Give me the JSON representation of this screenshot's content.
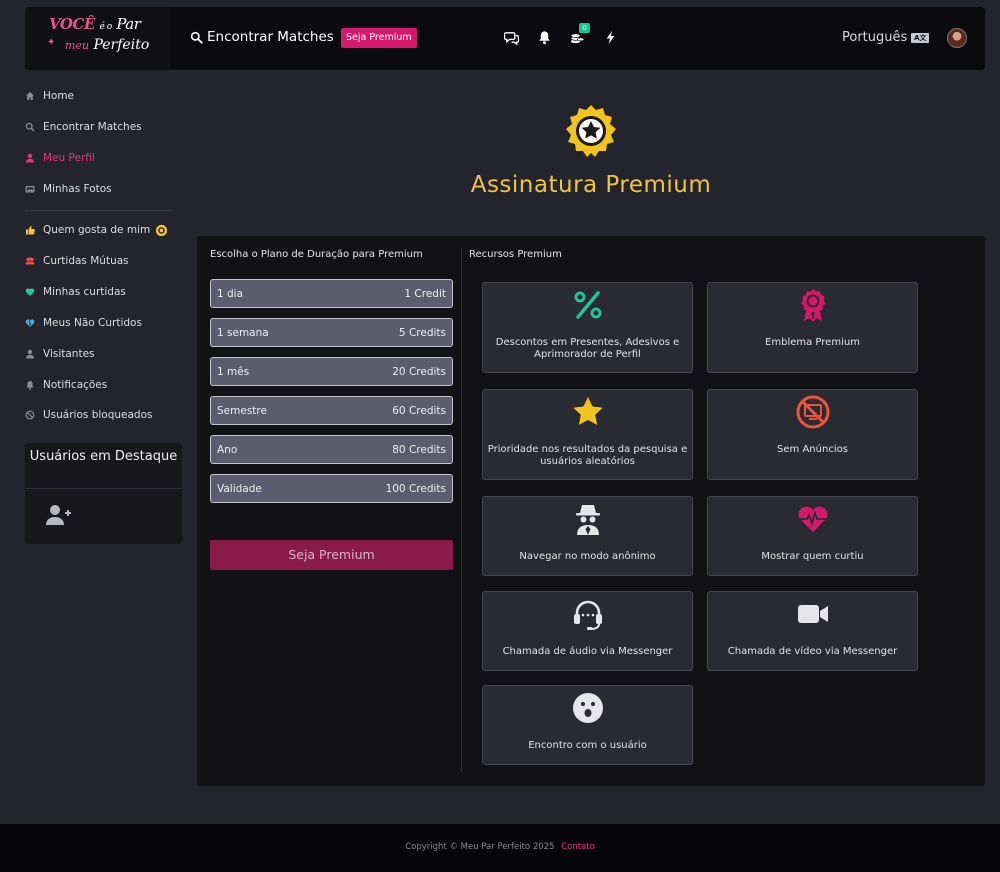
{
  "header": {
    "logo": {
      "line1_a": "VOCÊ",
      "line1_b": "é o",
      "line1_c": "Par",
      "line2_a": "meu",
      "line2_b": "Perfeito"
    },
    "search_label": "Encontrar Matches",
    "premium_badge": "Seja Premium",
    "coins_badge": "0",
    "language": "Português",
    "language_flag": "A文",
    "icons": [
      "chat-icon",
      "bell-icon",
      "coins-icon",
      "bolt-icon"
    ]
  },
  "sidebar": {
    "items": [
      {
        "label": "Home",
        "icon": "home-icon"
      },
      {
        "label": "Encontrar Matches",
        "icon": "search-icon"
      },
      {
        "label": "Meu Perfil",
        "icon": "user-icon",
        "active": true
      },
      {
        "label": "Minhas Fotos",
        "icon": "photos-icon"
      },
      {
        "label": "Quem gosta de mim",
        "icon": "thumbs-up-icon"
      },
      {
        "label": "Curtidas Mútuas",
        "icon": "users-icon"
      },
      {
        "label": "Minhas curtidas",
        "icon": "heart-icon"
      },
      {
        "label": "Meus Não Curtidos",
        "icon": "broken-heart-icon"
      },
      {
        "label": "Visitantes",
        "icon": "visitor-icon"
      },
      {
        "label": "Notificações",
        "icon": "bell-icon"
      },
      {
        "label": "Usuários bloqueados",
        "icon": "ban-icon"
      }
    ],
    "featured_title": "Usuários em Destaque"
  },
  "hero": {
    "title": "Assinatura Premium"
  },
  "plans": {
    "title": "Escolha o Plano de Duração para Premium",
    "items": [
      {
        "name": "1 dia",
        "price": "1 Credit"
      },
      {
        "name": "1 semana",
        "price": "5 Credits"
      },
      {
        "name": "1 mês",
        "price": "20 Credits"
      },
      {
        "name": "Semestre",
        "price": "60 Credits"
      },
      {
        "name": "Ano",
        "price": "80 Credits"
      },
      {
        "name": "Validade",
        "price": "100 Credits"
      }
    ],
    "cta": "Seja Premium"
  },
  "features": {
    "title": "Recursos Premium",
    "items": [
      {
        "label": "Descontos em Presentes, Adesivos e Aprimorador de Perfil",
        "icon": "percent-icon"
      },
      {
        "label": "Emblema Premium",
        "icon": "award-ribbon-icon"
      },
      {
        "label": "Prioridade nos resultados da pesquisa e usuários aleatórios",
        "icon": "star-icon"
      },
      {
        "label": "Sem Anúncios",
        "icon": "no-ads-icon"
      },
      {
        "label": "Navegar no modo anônimo",
        "icon": "incognito-icon"
      },
      {
        "label": "Mostrar quem curtiu",
        "icon": "heartbeat-icon"
      },
      {
        "label": "Chamada de áudio via Messenger",
        "icon": "headset-icon"
      },
      {
        "label": "Chamada de vídeo via Messenger",
        "icon": "video-camera-icon"
      },
      {
        "label": "Encontro com o usuário",
        "icon": "surprised-face-icon"
      }
    ]
  },
  "footer": {
    "copyright": "Copyright © Meu Par Perfeito 2025",
    "contact": "Contato"
  },
  "colors": {
    "accent_pink": "#d6186a",
    "accent_gold": "#f2c43a",
    "panel": "#121216",
    "background": "#24242e"
  }
}
